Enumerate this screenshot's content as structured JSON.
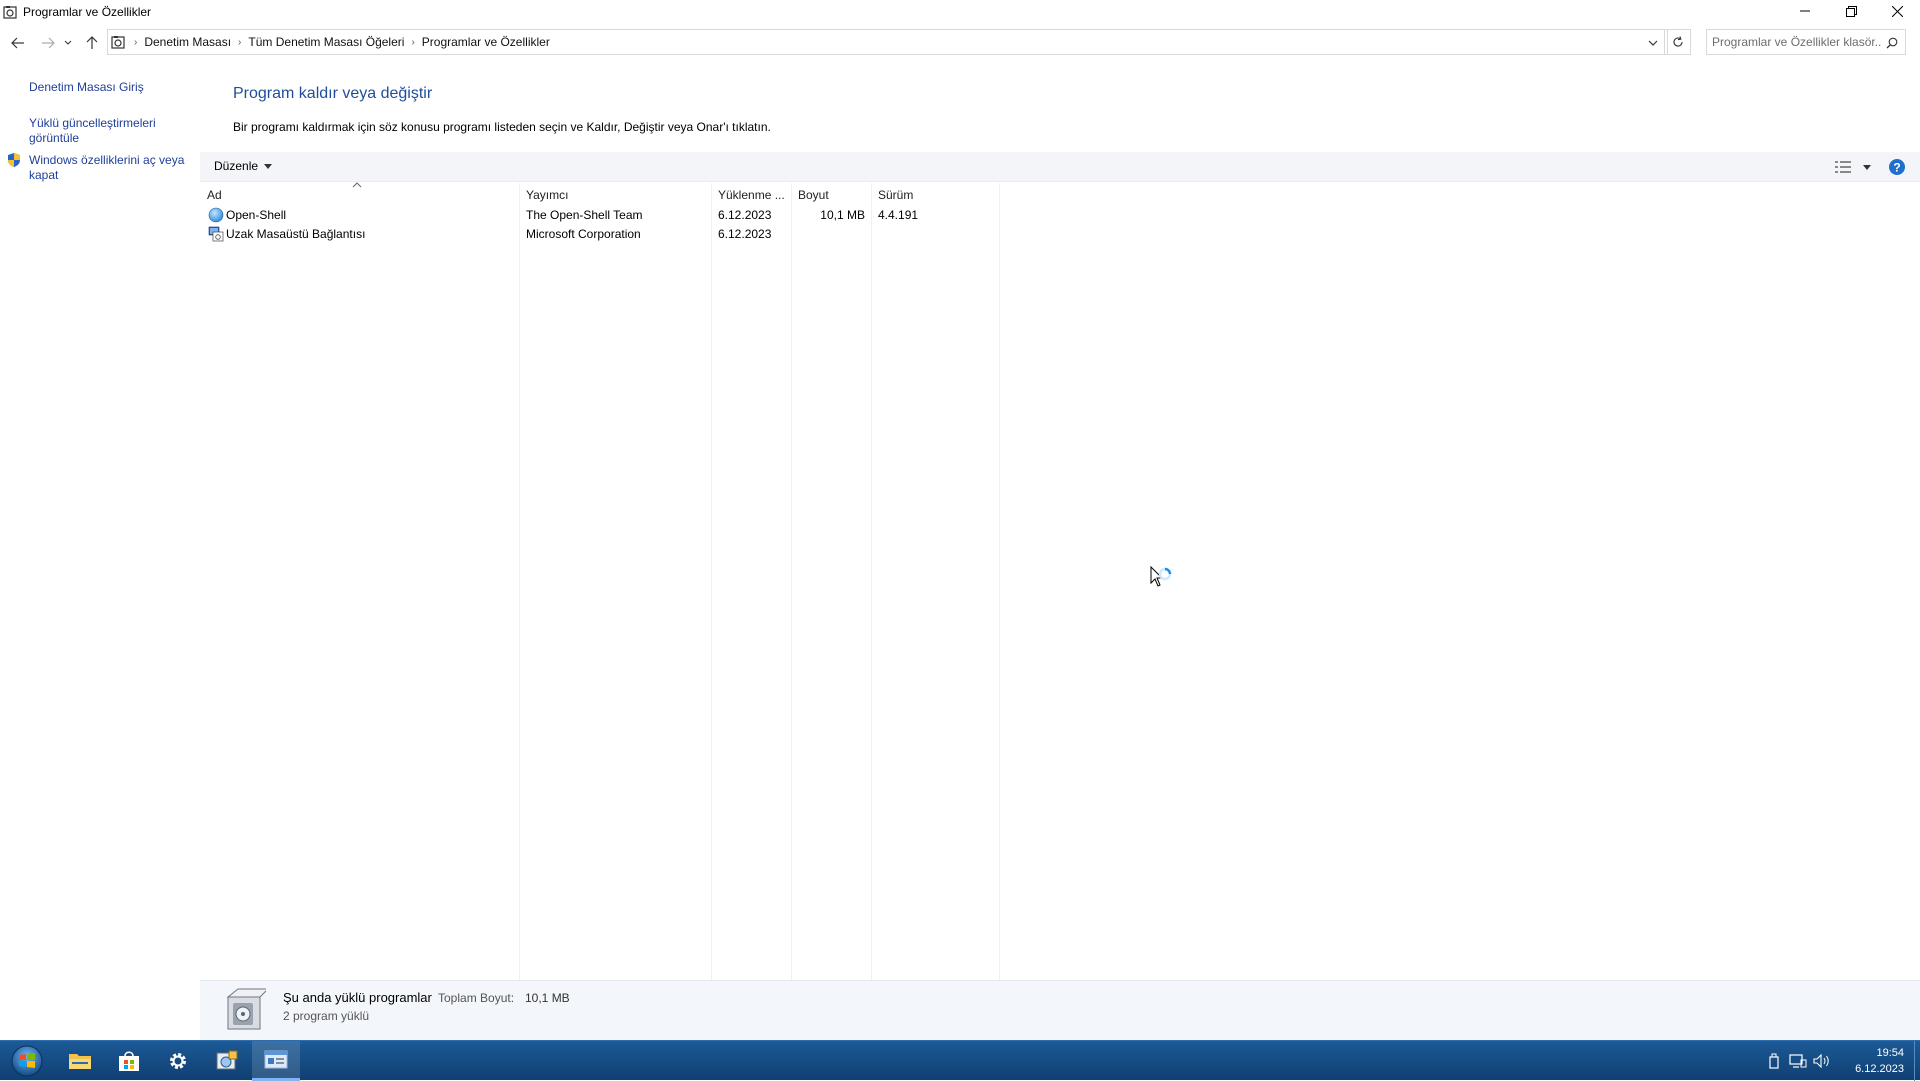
{
  "window": {
    "title": "Programlar ve Özellikler",
    "controls": {
      "minimize": "minimize",
      "maximize": "restore",
      "close": "close"
    }
  },
  "address_bar": {
    "breadcrumbs": [
      "Denetim Masası",
      "Tüm Denetim Masası Öğeleri",
      "Programlar ve Özellikler"
    ],
    "search_placeholder": "Programlar ve Özellikler klasör..."
  },
  "left_pane": {
    "links": [
      "Denetim Masası Giriş",
      "Yüklü güncelleştirmeleri",
      "görüntüle",
      "Windows özelliklerini aç veya",
      "kapat"
    ]
  },
  "main": {
    "title": "Program kaldır veya değiştir",
    "description": "Bir programı kaldırmak için söz konusu programı listeden seçin ve Kaldır, Değiştir veya Onar'ı tıklatın.",
    "toolbar": {
      "organize_label": "Düzenle"
    }
  },
  "list": {
    "columns": [
      "Ad",
      "Yayımcı",
      "Yüklenme ...",
      "Boyut",
      "Sürüm"
    ],
    "rows": [
      {
        "name": "Open-Shell",
        "publisher": "The Open-Shell Team",
        "installed": "6.12.2023",
        "size": "10,1 MB",
        "version": "4.4.191",
        "icon": "open-shell-icon"
      },
      {
        "name": "Uzak Masaüstü Bağlantısı",
        "publisher": "Microsoft Corporation",
        "installed": "6.12.2023",
        "size": "",
        "version": "",
        "icon": "remote-desktop-icon"
      }
    ]
  },
  "details": {
    "title": "Şu anda yüklü programlar",
    "total_label": "Toplam Boyut:",
    "total_value": "10,1 MB",
    "count": "2 program yüklü"
  },
  "taskbar": {
    "time": "19:54",
    "date": "6.12.2023",
    "colors": {
      "bar": "#14477d",
      "accent": "#7fb6f0"
    }
  }
}
